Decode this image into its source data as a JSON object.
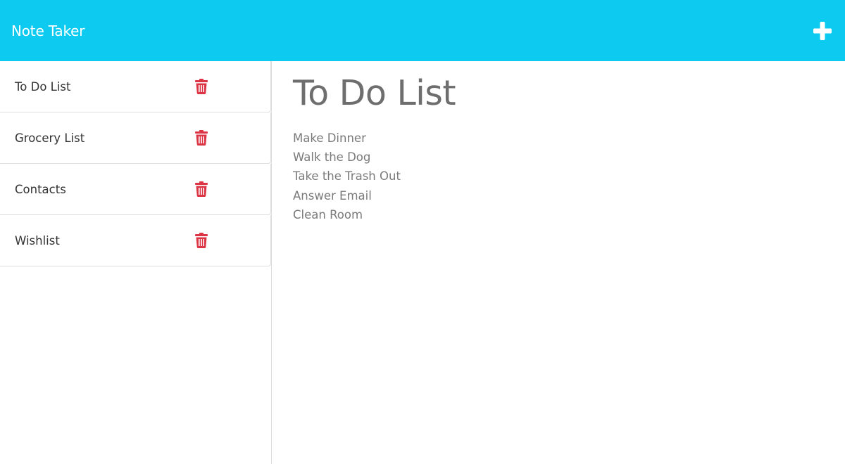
{
  "colors": {
    "navbar_bg": "#0dcaf0",
    "delete_icon": "#dc3545",
    "navbar_text": "#ffffff"
  },
  "navbar": {
    "title": "Note Taker",
    "add_icon": "plus-icon"
  },
  "sidebar": {
    "notes": [
      {
        "label": "To Do List",
        "delete_icon": "trash-icon"
      },
      {
        "label": "Grocery List",
        "delete_icon": "trash-icon"
      },
      {
        "label": "Contacts",
        "delete_icon": "trash-icon"
      },
      {
        "label": "Wishlist",
        "delete_icon": "trash-icon"
      }
    ]
  },
  "main": {
    "title": "To Do List",
    "lines": [
      "Make Dinner",
      "Walk the Dog",
      "Take the Trash Out",
      "Answer Email",
      "Clean Room"
    ]
  }
}
